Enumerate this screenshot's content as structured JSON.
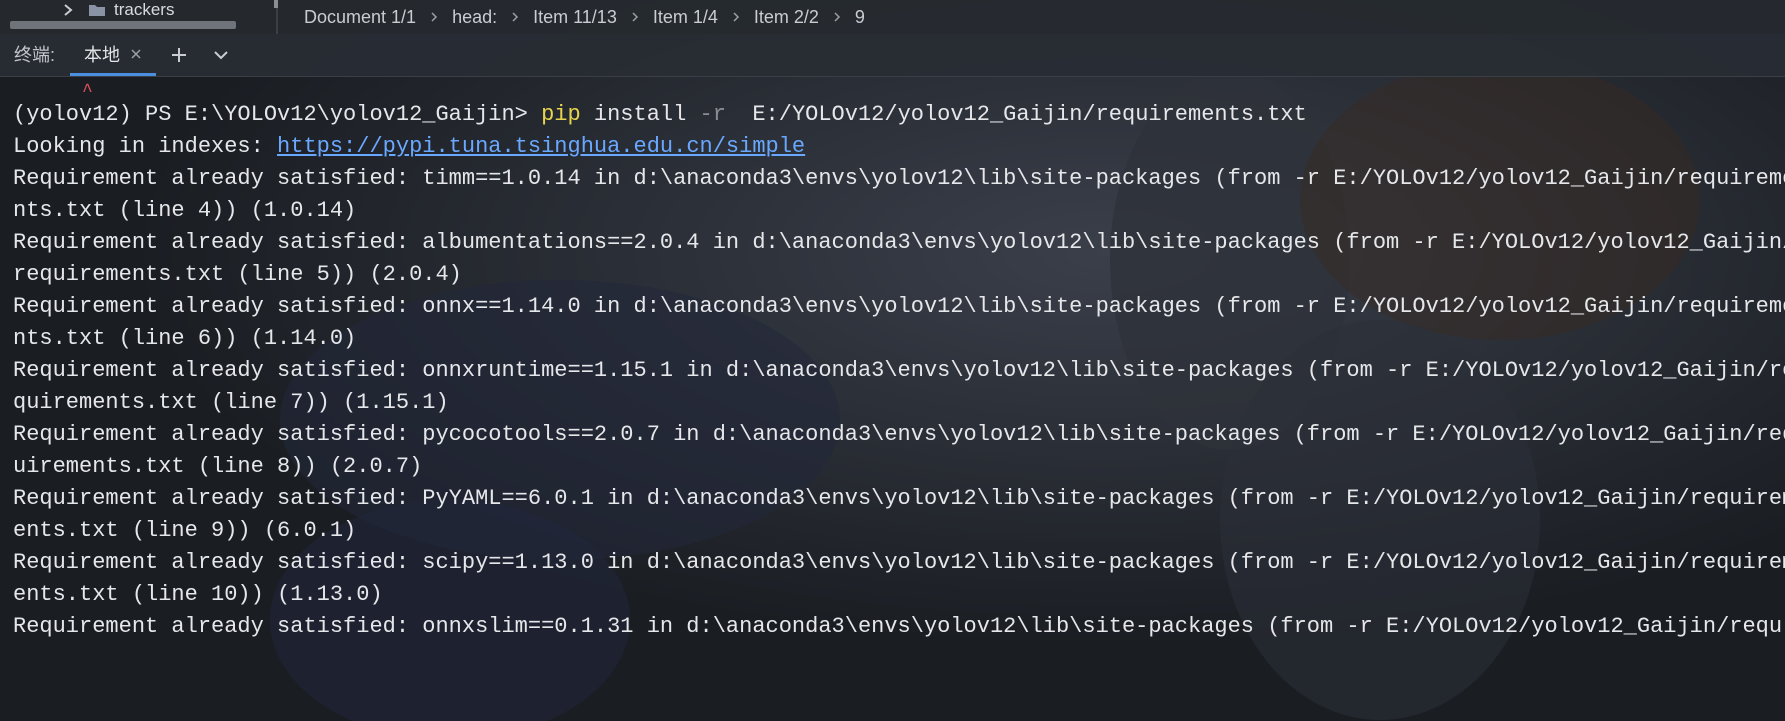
{
  "tree": {
    "item_label": "trackers"
  },
  "breadcrumb": [
    "Document 1/1",
    "head:",
    "Item 11/13",
    "Item 1/4",
    "Item 2/2",
    "9"
  ],
  "terminal_panel": {
    "title": "终端:",
    "tab_label": "本地"
  },
  "terminal": {
    "caret": "^",
    "prompt": "(yolov12) PS E:\\YOLOv12\\yolov12_Gaijin> ",
    "cmd_pip": "pip",
    "cmd_install": " install ",
    "cmd_flag": "-r",
    "cmd_path": "  E:/YOLOv12/yolov12_Gaijin/requirements.txt",
    "index_prefix": "Looking in indexes: ",
    "index_url": "https://pypi.tuna.tsinghua.edu.cn/simple",
    "output_lines": [
      "Requirement already satisfied: timm==1.0.14 in d:\\anaconda3\\envs\\yolov12\\lib\\site-packages (from -r E:/YOLOv12/yolov12_Gaijin/requireme",
      "nts.txt (line 4)) (1.0.14)",
      "Requirement already satisfied: albumentations==2.0.4 in d:\\anaconda3\\envs\\yolov12\\lib\\site-packages (from -r E:/YOLOv12/yolov12_Gaijin/",
      "requirements.txt (line 5)) (2.0.4)",
      "Requirement already satisfied: onnx==1.14.0 in d:\\anaconda3\\envs\\yolov12\\lib\\site-packages (from -r E:/YOLOv12/yolov12_Gaijin/requireme",
      "nts.txt (line 6)) (1.14.0)",
      "Requirement already satisfied: onnxruntime==1.15.1 in d:\\anaconda3\\envs\\yolov12\\lib\\site-packages (from -r E:/YOLOv12/yolov12_Gaijin/re",
      "quirements.txt (line 7)) (1.15.1)",
      "Requirement already satisfied: pycocotools==2.0.7 in d:\\anaconda3\\envs\\yolov12\\lib\\site-packages (from -r E:/YOLOv12/yolov12_Gaijin/req",
      "uirements.txt (line 8)) (2.0.7)",
      "Requirement already satisfied: PyYAML==6.0.1 in d:\\anaconda3\\envs\\yolov12\\lib\\site-packages (from -r E:/YOLOv12/yolov12_Gaijin/requirem",
      "ents.txt (line 9)) (6.0.1)",
      "Requirement already satisfied: scipy==1.13.0 in d:\\anaconda3\\envs\\yolov12\\lib\\site-packages (from -r E:/YOLOv12/yolov12_Gaijin/requirem",
      "ents.txt (line 10)) (1.13.0)",
      "Requirement already satisfied: onnxslim==0.1.31 in d:\\anaconda3\\envs\\yolov12\\lib\\site-packages (from -r E:/YOLOv12/yolov12_Gaijin/requ"
    ]
  },
  "colors": {
    "accent": "#4a8fe0",
    "pip": "#e8d44d",
    "link": "#6aa8ff"
  }
}
